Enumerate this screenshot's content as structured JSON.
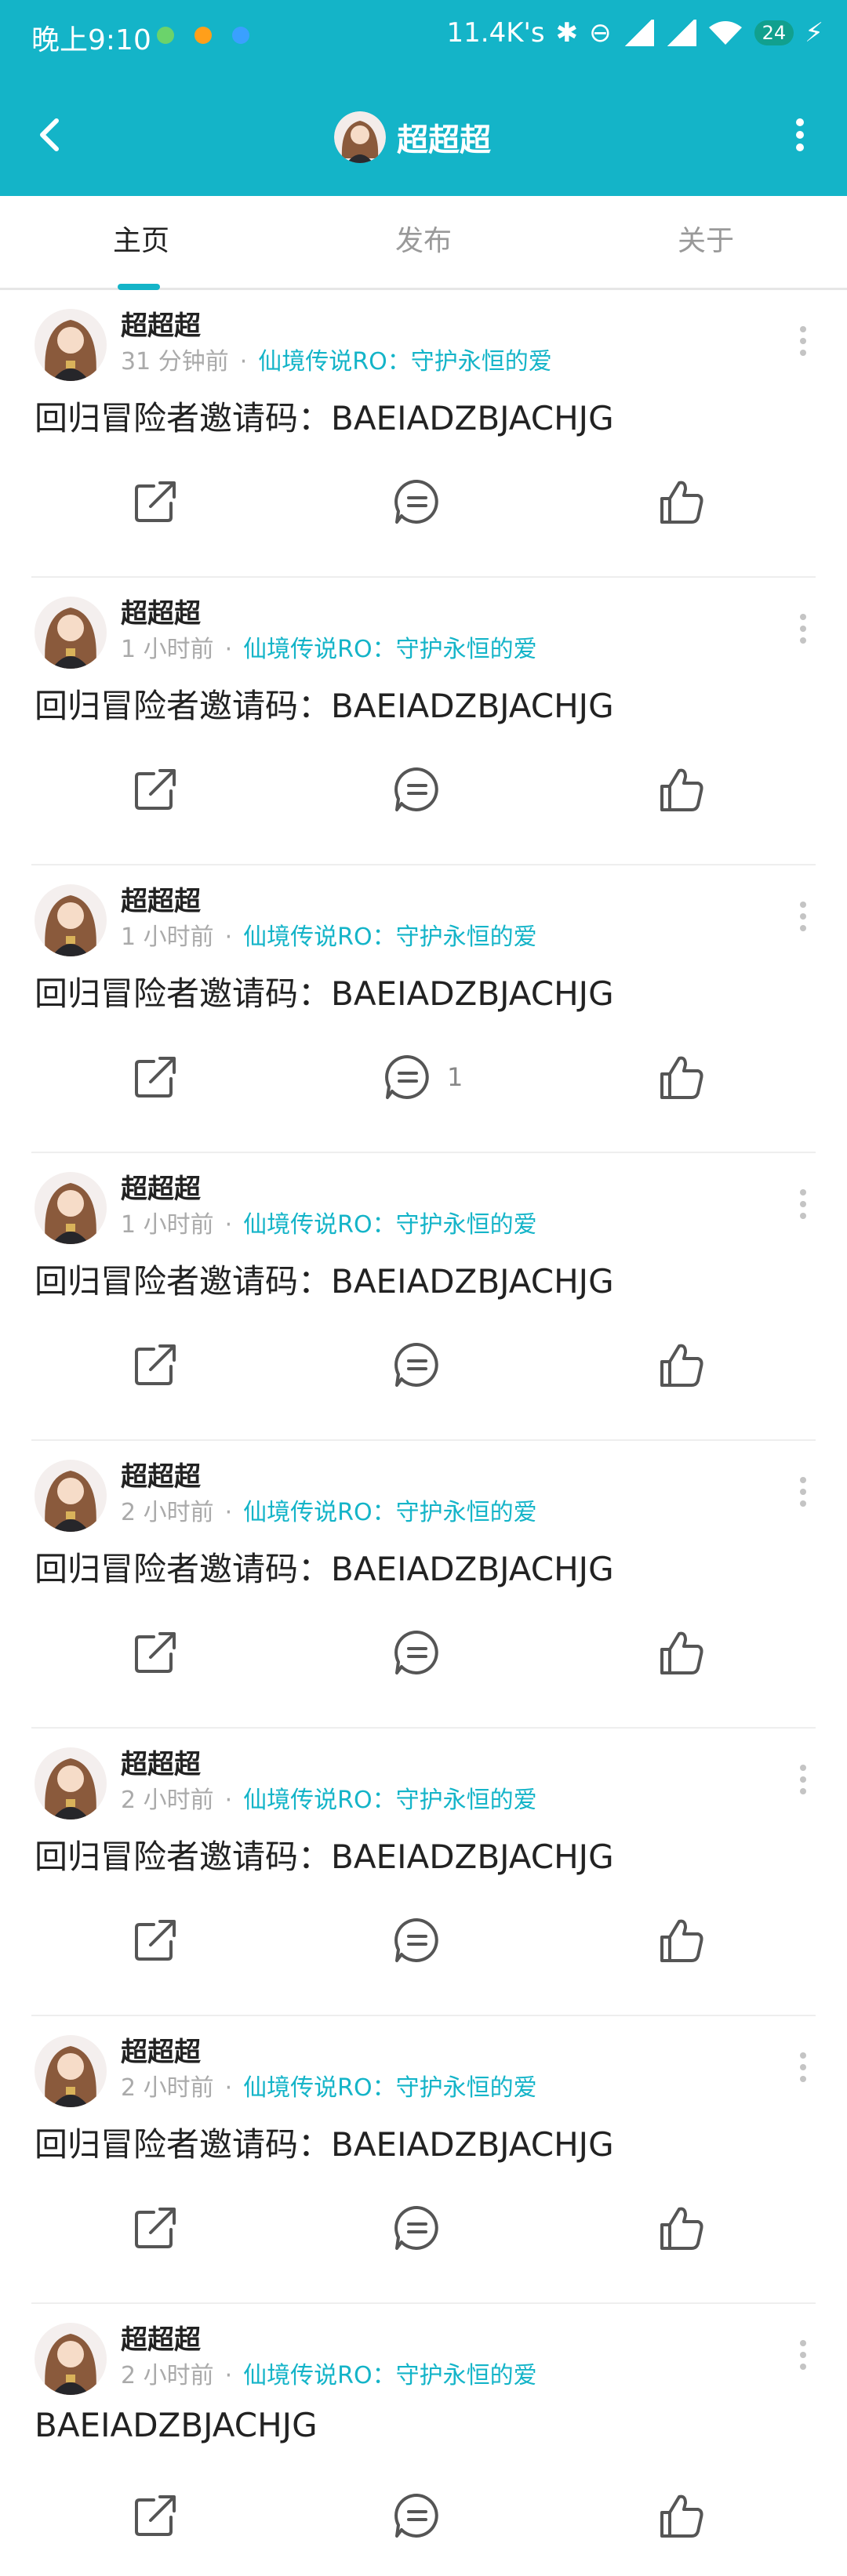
{
  "status_bar": {
    "time": "晚上9:10",
    "dots": [
      {
        "color": "#6bd36b"
      },
      {
        "color": "#ff9f1a"
      },
      {
        "color": "#3aa0ff"
      }
    ],
    "network_speed": "11.4K's",
    "battery": "24"
  },
  "header": {
    "title": "超超超"
  },
  "tabs": [
    {
      "label": "主页"
    },
    {
      "label": "发布"
    },
    {
      "label": "关于"
    }
  ],
  "colors": {
    "accent": "#14b4c8"
  },
  "posts": [
    {
      "author": "超超超",
      "time": "31 分钟前",
      "game": "仙境传说RO：守护永恒的爱",
      "content": "回归冒险者邀请码：BAEIADZBJACHJG",
      "comment_count": ""
    },
    {
      "author": "超超超",
      "time": "1 小时前",
      "game": "仙境传说RO：守护永恒的爱",
      "content": "回归冒险者邀请码：BAEIADZBJACHJG",
      "comment_count": ""
    },
    {
      "author": "超超超",
      "time": "1 小时前",
      "game": "仙境传说RO：守护永恒的爱",
      "content": "回归冒险者邀请码：BAEIADZBJACHJG",
      "comment_count": "1"
    },
    {
      "author": "超超超",
      "time": "1 小时前",
      "game": "仙境传说RO：守护永恒的爱",
      "content": "回归冒险者邀请码：BAEIADZBJACHJG",
      "comment_count": ""
    },
    {
      "author": "超超超",
      "time": "2 小时前",
      "game": "仙境传说RO：守护永恒的爱",
      "content": "回归冒险者邀请码：BAEIADZBJACHJG",
      "comment_count": ""
    },
    {
      "author": "超超超",
      "time": "2 小时前",
      "game": "仙境传说RO：守护永恒的爱",
      "content": "回归冒险者邀请码：BAEIADZBJACHJG",
      "comment_count": ""
    },
    {
      "author": "超超超",
      "time": "2 小时前",
      "game": "仙境传说RO：守护永恒的爱",
      "content": "回归冒险者邀请码：BAEIADZBJACHJG",
      "comment_count": ""
    },
    {
      "author": "超超超",
      "time": "2 小时前",
      "game": "仙境传说RO：守护永恒的爱",
      "content": "BAEIADZBJACHJG",
      "comment_count": ""
    }
  ]
}
